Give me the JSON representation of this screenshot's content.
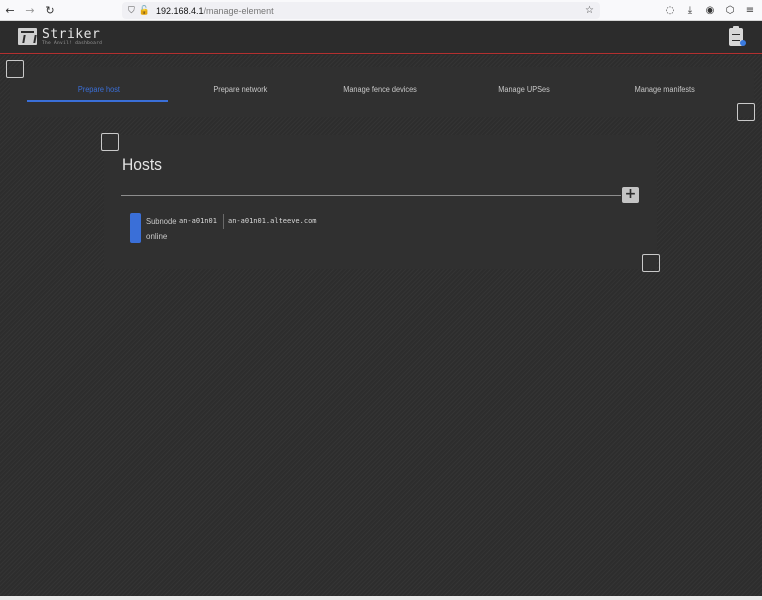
{
  "browser": {
    "url_host": "192.168.4.1",
    "url_path": "/manage-element"
  },
  "app": {
    "brand_name": "Striker",
    "brand_subtitle": "The Anvil! dashboard"
  },
  "tabs": [
    {
      "label": "Prepare host",
      "active": true
    },
    {
      "label": "Prepare network",
      "active": false
    },
    {
      "label": "Manage fence devices",
      "active": false
    },
    {
      "label": "Manage UPSes",
      "active": false
    },
    {
      "label": "Manage manifests",
      "active": false
    }
  ],
  "hosts": {
    "title": "Hosts",
    "add_label": "+",
    "items": [
      {
        "type": "Subnode",
        "short_name": "an-a01n01",
        "fqdn": "an-a01n01.alteeve.com",
        "status": "online",
        "status_color": "#3a6fd8"
      }
    ]
  },
  "colors": {
    "accent": "#3a6fd8",
    "header_border": "#b33030"
  }
}
